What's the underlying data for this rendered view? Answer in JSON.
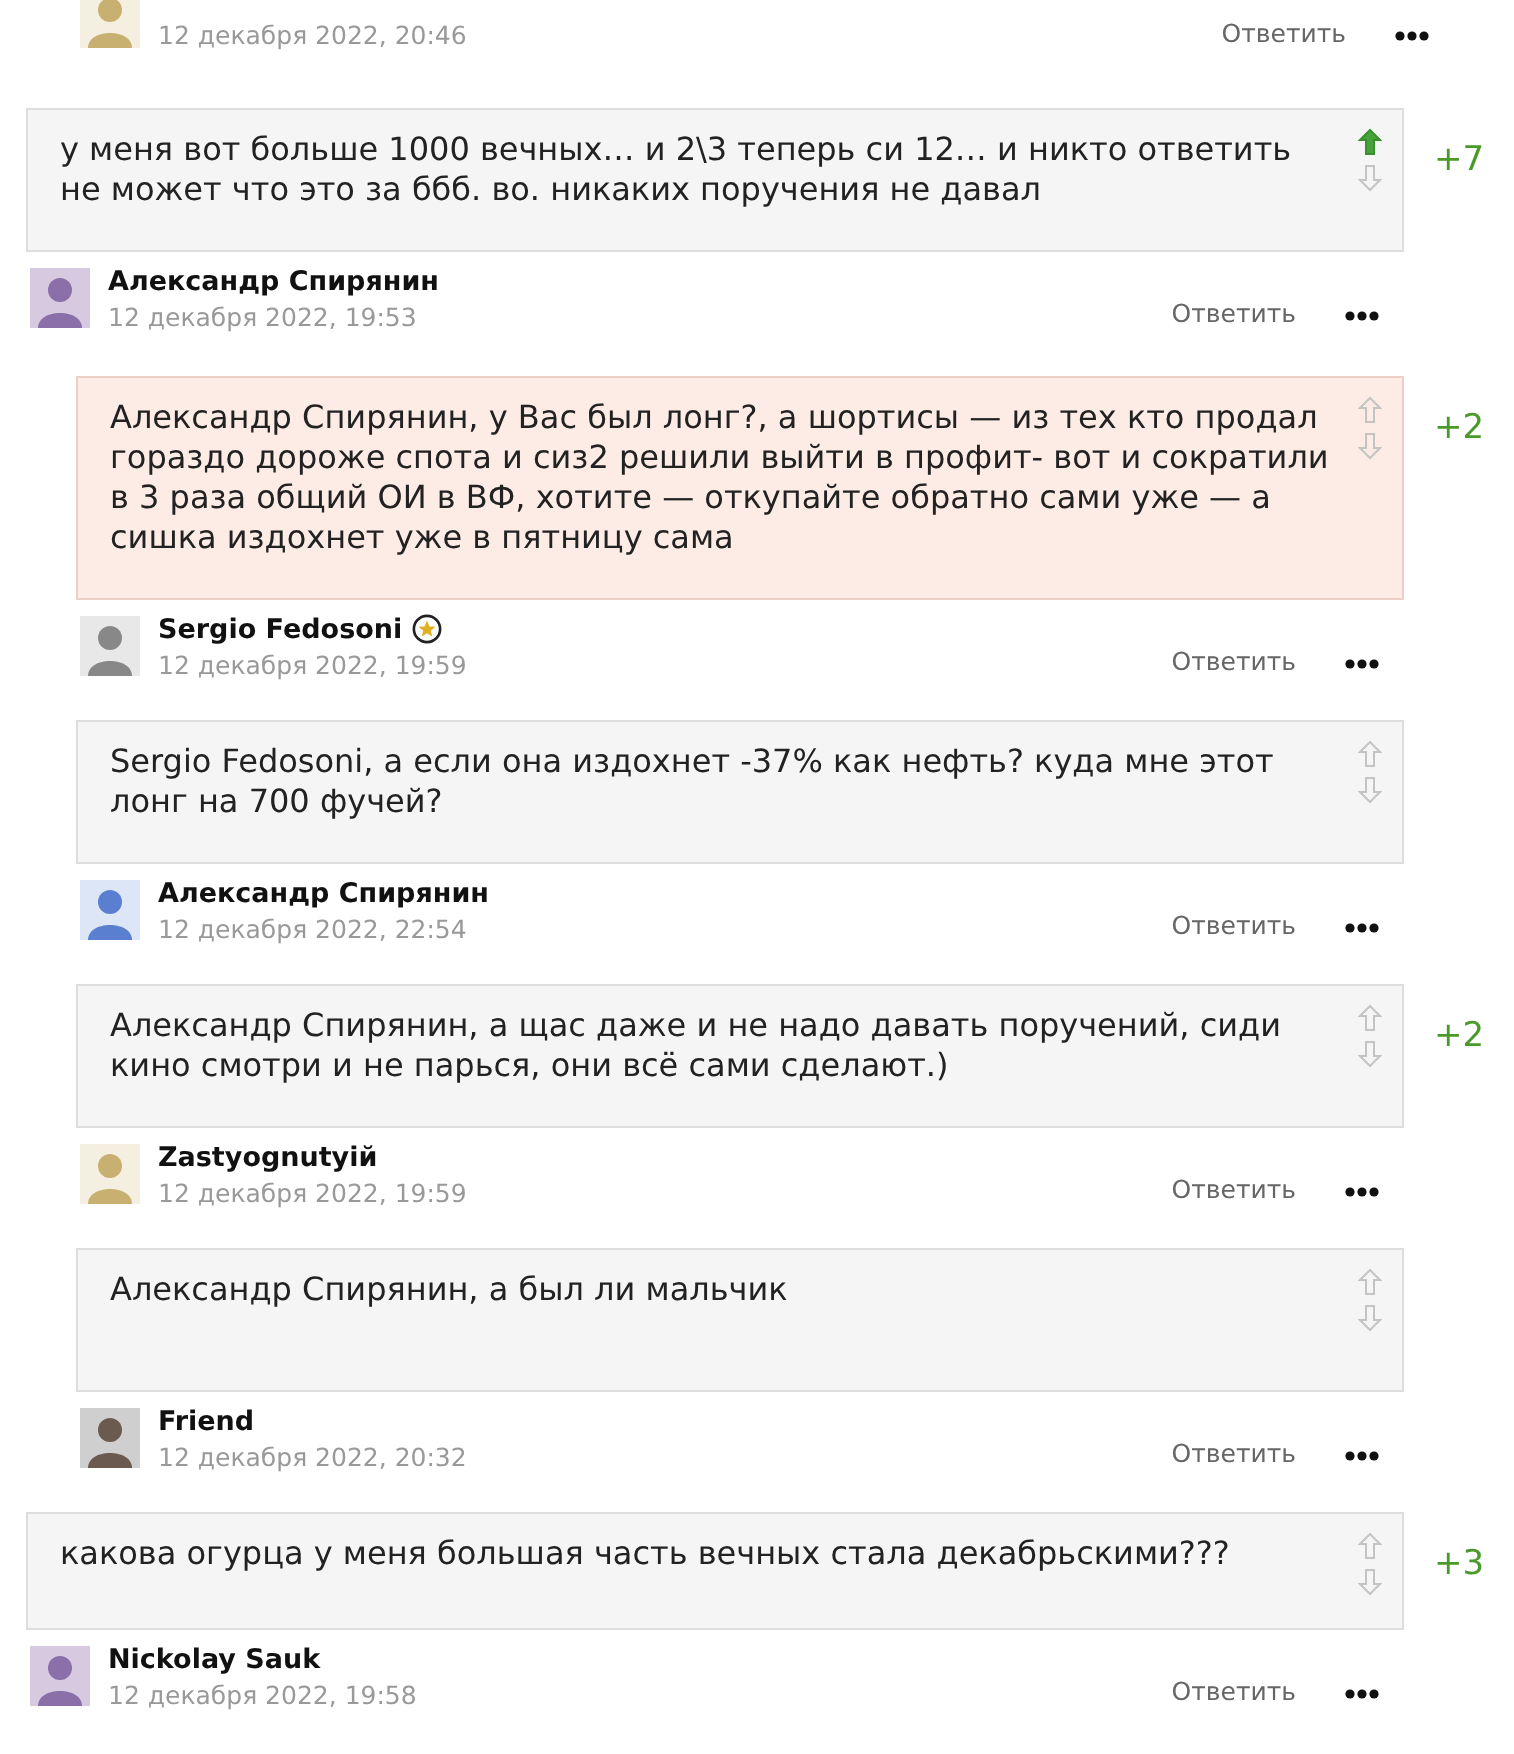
{
  "top_meta": {
    "date": "12 декабря 2022, 20:46",
    "reply": "Ответить"
  },
  "comments": [
    {
      "text": "у меня вот больше 1000 вечных… и 2\\3 теперь си 12… и никто ответить не может что это за ббб. во. никаких поручения не давал",
      "highlighted": false,
      "upvoted": true,
      "score": "+7",
      "author": "Александр Спирянин",
      "starred": false,
      "date": "12 декабря 2022, 19:53",
      "reply": "Ответить",
      "children": [
        {
          "text": "Александр Спирянин, у Вас  был лонг?, а шортисы — из тех кто продал гораздо дороже спота и сиз2 решили выйти  в профит- вот и сократили в 3 раза общий ОИ в ВФ, хотите — откупайте обратно сами уже — а сишка издохнет уже в пятницу сама",
          "highlighted": true,
          "upvoted": false,
          "score": "+2",
          "author": "Sergio Fedosoni",
          "starred": true,
          "date": "12 декабря 2022, 19:59",
          "reply": "Ответить"
        },
        {
          "text": "Sergio Fedosoni, а если она издохнет -37% как нефть? куда мне этот лонг на 700 фучей?",
          "highlighted": false,
          "upvoted": false,
          "author": "Александр Спирянин",
          "starred": false,
          "date": "12 декабря 2022, 22:54",
          "reply": "Ответить"
        },
        {
          "text": "Александр Спирянин, а щас даже и не надо давать поручений, сиди кино смотри и не парься, они всё сами сделают.)",
          "highlighted": false,
          "upvoted": false,
          "score": "+2",
          "author": "Zastyognutyiй",
          "starred": false,
          "date": "12 декабря 2022, 19:59",
          "reply": "Ответить"
        },
        {
          "text": "Александр Спирянин, а был ли мальчик",
          "highlighted": false,
          "upvoted": false,
          "author": "Friend",
          "starred": false,
          "date": "12 декабря 2022, 20:32",
          "reply": "Ответить"
        }
      ]
    },
    {
      "text": "какова огурца у меня большая часть вечных стала декабрьскими???",
      "highlighted": false,
      "upvoted": false,
      "score": "+3",
      "author": "Nickolay Sauk",
      "starred": false,
      "date": "12 декабря 2022, 19:58",
      "reply": "Ответить"
    }
  ]
}
